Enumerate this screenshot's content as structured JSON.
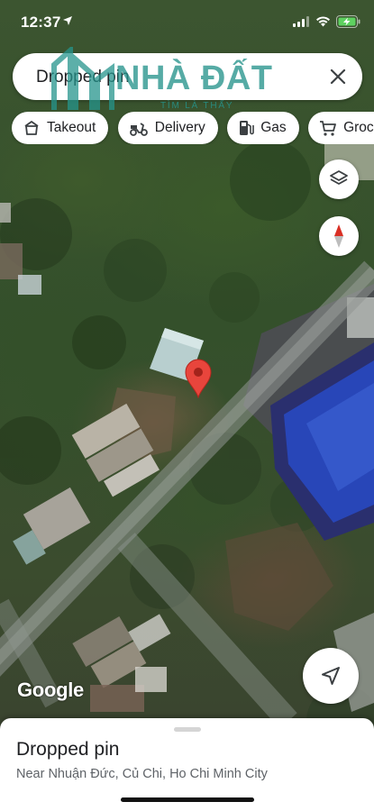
{
  "status_bar": {
    "time": "12:37"
  },
  "search": {
    "text": "Dropped pin"
  },
  "watermark": {
    "main": "NHÀ ĐẤT",
    "sub": "TÌM LÀ THẤY"
  },
  "chips": [
    {
      "label": "Takeout",
      "icon": "takeout-icon"
    },
    {
      "label": "Delivery",
      "icon": "scooter-icon"
    },
    {
      "label": "Gas",
      "icon": "gas-pump-icon"
    },
    {
      "label": "Groceri",
      "icon": "cart-icon"
    }
  ],
  "map": {
    "logo": "Google"
  },
  "place": {
    "title": "Dropped pin",
    "subtitle": "Near Nhuận Đức, Củ Chi, Ho Chi Minh City"
  },
  "colors": {
    "pin": "#e8453c",
    "compass_red": "#d93025",
    "watermark": "#26948c"
  }
}
